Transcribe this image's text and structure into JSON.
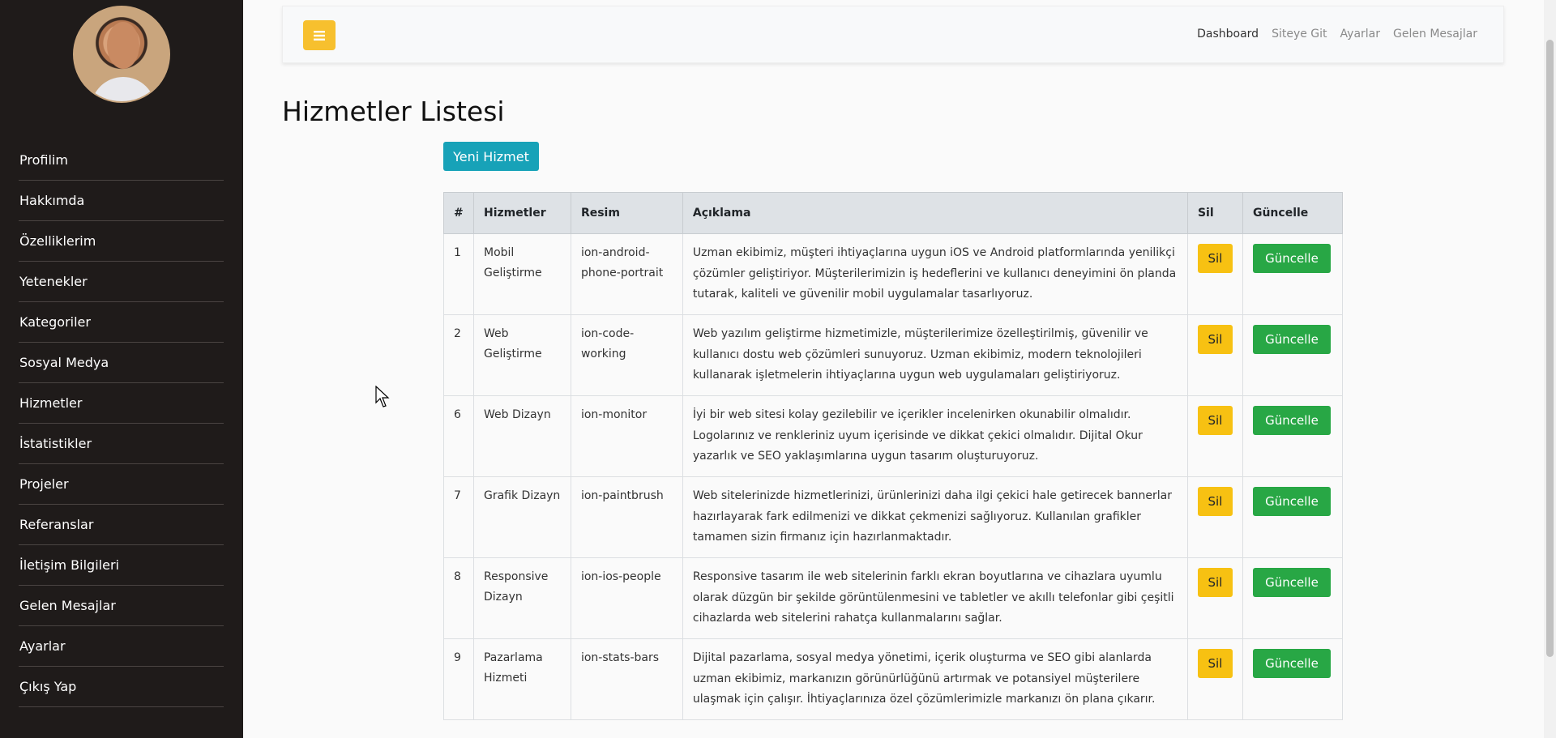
{
  "sidebar": {
    "items": [
      {
        "label": "Profilim"
      },
      {
        "label": "Hakkımda"
      },
      {
        "label": "Özelliklerim"
      },
      {
        "label": "Yetenekler"
      },
      {
        "label": "Kategoriler"
      },
      {
        "label": "Sosyal Medya"
      },
      {
        "label": "Hizmetler"
      },
      {
        "label": "İstatistikler"
      },
      {
        "label": "Projeler"
      },
      {
        "label": "Referanslar"
      },
      {
        "label": "İletişim Bilgileri"
      },
      {
        "label": "Gelen Mesajlar"
      },
      {
        "label": "Ayarlar"
      },
      {
        "label": "Çıkış Yap"
      }
    ]
  },
  "topbar": {
    "menu_icon": "bars-icon",
    "links": [
      "Dashboard",
      "Siteye Git",
      "Ayarlar",
      "Gelen Mesajlar"
    ]
  },
  "main": {
    "title": "Hizmetler Listesi",
    "new_button": "Yeni Hizmet",
    "table": {
      "headers": [
        "#",
        "Hizmetler",
        "Resim",
        "Açıklama",
        "Sil",
        "Güncelle"
      ],
      "delete_label": "Sil",
      "update_label": "Güncelle",
      "rows": [
        {
          "id": "1",
          "name": "Mobil Geliştirme",
          "icon": "ion-android-phone-portrait",
          "desc": "Uzman ekibimiz, müşteri ihtiyaçlarına uygun iOS ve Android platformlarında yenilikçi çözümler geliştiriyor. Müşterilerimizin iş hedeflerini ve kullanıcı deneyimini ön planda tutarak, kaliteli ve güvenilir mobil uygulamalar tasarlıyoruz."
        },
        {
          "id": "2",
          "name": "Web Geliştirme",
          "icon": "ion-code-working",
          "desc": "Web yazılım geliştirme hizmetimizle, müşterilerimize özelleştirilmiş, güvenilir ve kullanıcı dostu web çözümleri sunuyoruz. Uzman ekibimiz, modern teknolojileri kullanarak işletmelerin ihtiyaçlarına uygun web uygulamaları geliştiriyoruz."
        },
        {
          "id": "6",
          "name": "Web Dizayn",
          "icon": "ion-monitor",
          "desc": "İyi bir web sitesi kolay gezilebilir ve içerikler incelenirken okunabilir olmalıdır. Logolarınız ve renkleriniz uyum içerisinde ve dikkat çekici olmalıdır. Dijital Okur yazarlık ve SEO yaklaşımlarına uygun tasarım oluşturuyoruz."
        },
        {
          "id": "7",
          "name": "Grafik Dizayn",
          "icon": "ion-paintbrush",
          "desc": "Web sitelerinizde hizmetlerinizi, ürünlerinizi daha ilgi çekici hale getirecek bannerlar hazırlayarak fark edilmenizi ve dikkat çekmenizi sağlıyoruz. Kullanılan grafikler tamamen sizin firmanız için hazırlanmaktadır."
        },
        {
          "id": "8",
          "name": "Responsive Dizayn",
          "icon": "ion-ios-people",
          "desc": "Responsive tasarım ile web sitelerinin farklı ekran boyutlarına ve cihazlara uyumlu olarak düzgün bir şekilde görüntülenmesini ve tabletler ve akıllı telefonlar gibi çeşitli cihazlarda web sitelerini rahatça kullanmalarını sağlar."
        },
        {
          "id": "9",
          "name": "Pazarlama Hizmeti",
          "icon": "ion-stats-bars",
          "desc": "Dijital pazarlama, sosyal medya yönetimi, içerik oluşturma ve SEO gibi alanlarda uzman ekibimiz, markanızın görünürlüğünü artırmak ve potansiyel müşterilere ulaşmak için çalışır. İhtiyaçlarınıza özel çözümlerimizle markanızı ön plana çıkarır."
        }
      ]
    }
  },
  "colors": {
    "sidebar_bg": "#1f1b1a",
    "menu_button": "#f7c02e",
    "new_button": "#17a2b8",
    "delete_button": "#f7c112",
    "update_button": "#28a745"
  }
}
